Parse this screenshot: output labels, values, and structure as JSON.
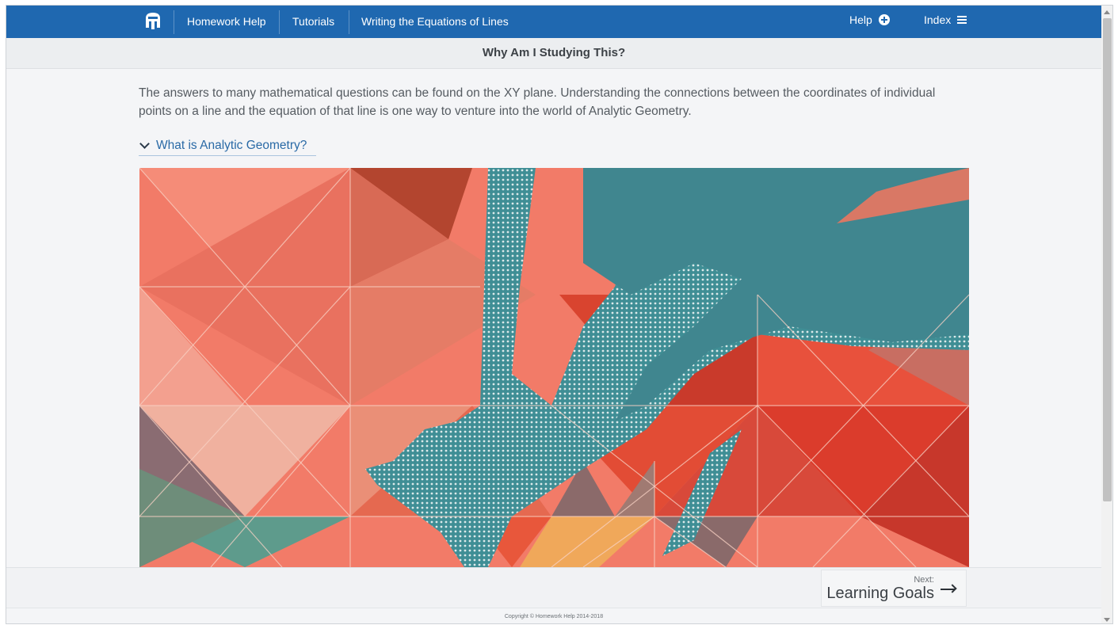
{
  "nav": {
    "logo_icon": "helmet-logo-icon",
    "links": [
      "Homework Help",
      "Tutorials",
      "Writing the Equations of Lines"
    ],
    "help_label": "Help",
    "help_icon": "plus-circle-icon",
    "index_label": "Index",
    "index_icon": "hamburger-menu-icon",
    "color": "#1f68b0"
  },
  "subheader": {
    "title": "Why Am I Studying This?"
  },
  "main": {
    "intro": "The answers to many mathematical questions can be found on the XY plane. Understanding the connections between the coordinates of individual points on a line and the equation of that line is one way to venture into the world of Analytic Geometry.",
    "expander_label": "What is Analytic Geometry?",
    "expander_icon": "chevron-down-icon",
    "link_color": "#2a6aa6"
  },
  "bottom": {
    "next_label": "Next:",
    "next_title": "Learning Goals",
    "next_icon": "arrow-right-icon"
  },
  "footer": {
    "copyright": "Copyright © Homework Help 2014-2018"
  }
}
